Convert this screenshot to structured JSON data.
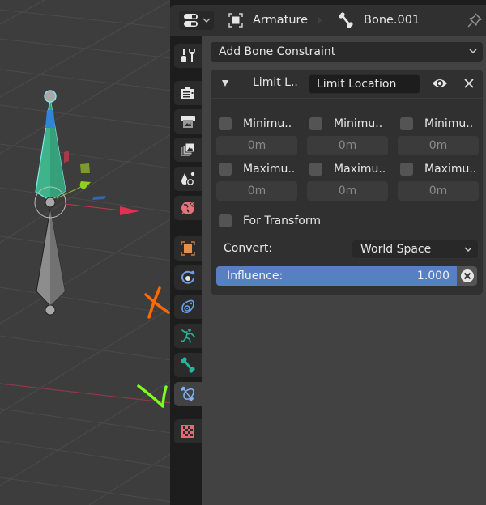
{
  "header": {
    "editor_type_icon": "properties-editor-icon",
    "breadcrumb": [
      {
        "icon": "object-icon",
        "label": "Armature"
      },
      {
        "icon": "bone-icon",
        "label": "Bone.001"
      }
    ],
    "pin_icon": "pin-icon"
  },
  "tabs": [
    {
      "name": "tool",
      "icon": "tool-icon",
      "color": "#e6e6e6",
      "active": false
    },
    {
      "name": "render",
      "icon": "render-icon",
      "color": "#e6e6e6",
      "active": false
    },
    {
      "name": "output",
      "icon": "output-icon",
      "color": "#e6e6e6",
      "active": false
    },
    {
      "name": "view-layer",
      "icon": "view-layer-icon",
      "color": "#e6e6e6",
      "active": false
    },
    {
      "name": "scene",
      "icon": "scene-icon",
      "color": "#e6e6e6",
      "active": false
    },
    {
      "name": "world",
      "icon": "world-icon",
      "color": "#e7737a",
      "active": false
    },
    {
      "name": "object",
      "icon": "object-icon",
      "color": "#e5904a",
      "active": false
    },
    {
      "name": "physics",
      "icon": "physics-icon",
      "color": "#6d9fe0",
      "active": false
    },
    {
      "name": "object-constraints",
      "icon": "object-constraint-icon",
      "color": "#6d9fe0",
      "active": false
    },
    {
      "name": "object-data",
      "icon": "armature-data-icon",
      "color": "#27b59a",
      "active": false
    },
    {
      "name": "bone",
      "icon": "bone-icon",
      "color": "#27b59a",
      "active": false
    },
    {
      "name": "bone-constraints",
      "icon": "bone-constraint-icon",
      "color": "#7fb3f5",
      "active": true
    },
    {
      "name": "texture",
      "icon": "texture-icon",
      "color": "#e06b74",
      "active": false
    }
  ],
  "content": {
    "add_constraint_label": "Add Bone Constraint",
    "constraint": {
      "type_label": "Limit L..",
      "name": "Limit Location",
      "min_labels": [
        "Minimu..",
        "Minimu..",
        "Minimu.."
      ],
      "min_values": [
        "0m",
        "0m",
        "0m"
      ],
      "max_labels": [
        "Maximu..",
        "Maximu..",
        "Maximu.."
      ],
      "max_values": [
        "0m",
        "0m",
        "0m"
      ],
      "min_checked": [
        false,
        false,
        false
      ],
      "max_checked": [
        false,
        false,
        false
      ],
      "for_transform_label": "For Transform",
      "for_transform_checked": false,
      "convert_label": "Convert:",
      "convert_value": "World Space",
      "influence_label": "Influence:",
      "influence_value": "1.000"
    }
  },
  "annotations": {
    "cross_mark_color": "#ff6a00",
    "check_mark_color": "#7cff1e"
  },
  "colors": {
    "accent": "#5680c2",
    "selected_bone": "#3fb38a",
    "bone_outline": "#7fe8f0"
  }
}
